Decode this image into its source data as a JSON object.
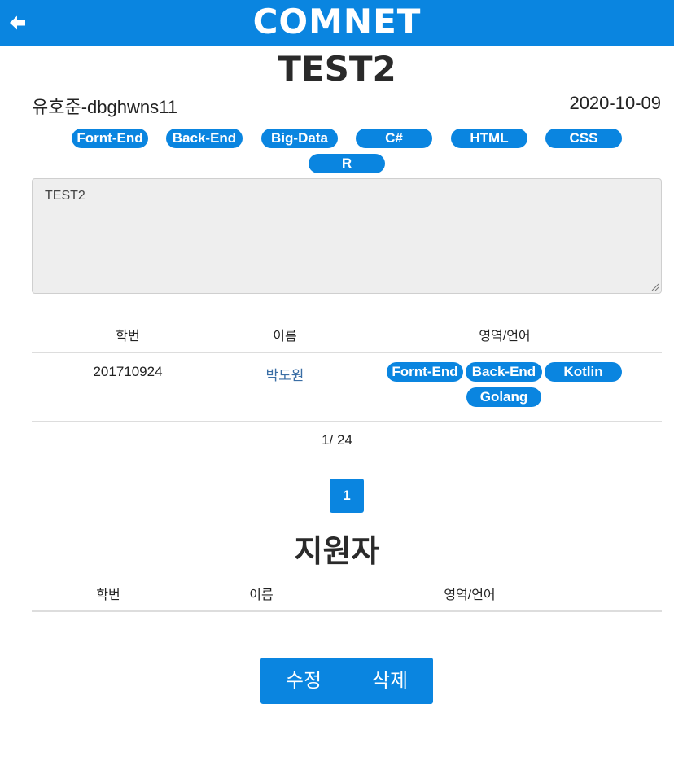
{
  "header": {
    "title": "COMNET",
    "back_icon": "arrow-left-icon",
    "color": "#0a85e0"
  },
  "post": {
    "title": "TEST2",
    "author": "유호준-dbghwns11",
    "date": "2020-10-09",
    "tags": [
      "Fornt-End",
      "Back-End",
      "Big-Data",
      "C#",
      "HTML",
      "CSS",
      "R"
    ],
    "content": "TEST2"
  },
  "members_table": {
    "headers": [
      "학번",
      "이름",
      "영역/언어"
    ],
    "rows": [
      {
        "student_id": "201710924",
        "name": "박도원",
        "tags": [
          "Fornt-End",
          "Back-End",
          "Kotlin",
          "Golang"
        ]
      }
    ]
  },
  "pagination": {
    "count_text": "1/ 24",
    "current_page": "1"
  },
  "applicants": {
    "title": "지원자",
    "headers": [
      "학번",
      "이름",
      "영역/언어"
    ]
  },
  "actions": {
    "edit_label": "수정",
    "delete_label": "삭제"
  }
}
